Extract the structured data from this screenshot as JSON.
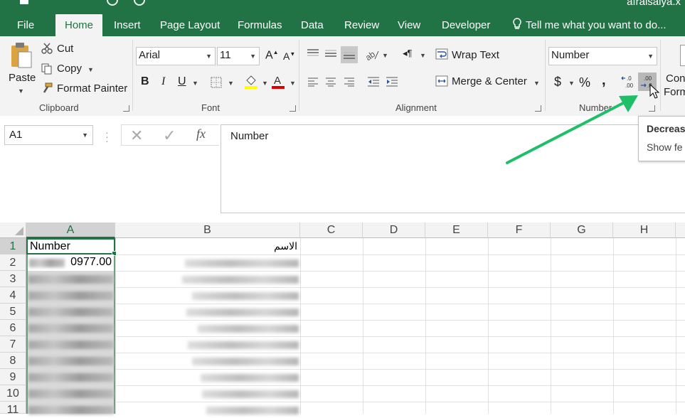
{
  "window": {
    "title_partial": "afraisalya.x"
  },
  "tabs": [
    {
      "label": "File"
    },
    {
      "label": "Home"
    },
    {
      "label": "Insert"
    },
    {
      "label": "Page Layout"
    },
    {
      "label": "Formulas"
    },
    {
      "label": "Data"
    },
    {
      "label": "Review"
    },
    {
      "label": "View"
    },
    {
      "label": "Developer"
    }
  ],
  "tell_me": "Tell me what you want to do...",
  "clipboard": {
    "paste": "Paste",
    "cut": "Cut",
    "copy": "Copy",
    "format_painter": "Format Painter",
    "group": "Clipboard"
  },
  "font": {
    "name": "Arial",
    "size": "11",
    "bold": "B",
    "italic": "I",
    "underline": "U",
    "group": "Font"
  },
  "alignment": {
    "wrap_text": "Wrap Text",
    "merge_center": "Merge & Center",
    "group": "Alignment"
  },
  "number": {
    "format": "Number",
    "currency": "$",
    "percent": "%",
    "comma": ",",
    "group": "Number"
  },
  "next_group_partial": [
    "Con",
    "Form"
  ],
  "tooltip": {
    "title_partial": "Decreas",
    "body_partial": "Show fe"
  },
  "formula_bar": {
    "name_box": "A1",
    "fx": "fx",
    "content": "Number"
  },
  "columns": [
    "A",
    "B",
    "C",
    "D",
    "E",
    "F",
    "G",
    "H"
  ],
  "rows": [
    "1",
    "2",
    "3",
    "4",
    "5",
    "6",
    "7",
    "8",
    "9",
    "10",
    "11"
  ],
  "cells": {
    "A1": "Number",
    "B1": "الاسم",
    "A2": "0977.00"
  },
  "colors": {
    "accent": "#217346",
    "arrow": "#1fbf6a"
  },
  "icons": [
    "save-icon",
    "cut-icon",
    "copy-icon",
    "format-painter-icon",
    "paste-icon",
    "font-color-icon",
    "fill-color-icon",
    "borders-icon",
    "wrap-text-icon",
    "merge-center-icon",
    "increase-decimal-icon",
    "decrease-decimal-icon",
    "lightbulb-icon",
    "cursor-icon"
  ]
}
